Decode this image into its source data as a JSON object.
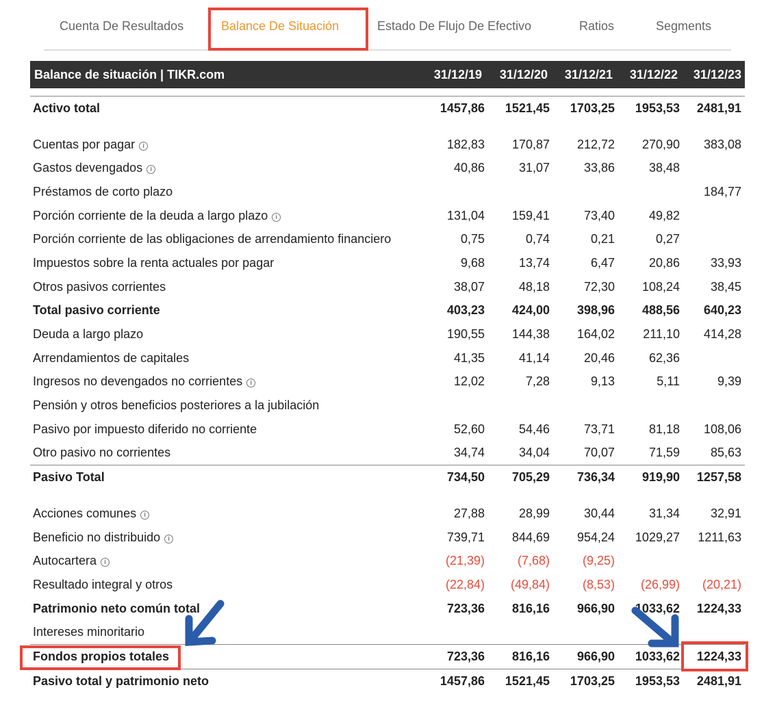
{
  "tabs": [
    {
      "label": "Cuenta De Resultados",
      "active": false
    },
    {
      "label": "Balance De Situación",
      "active": true
    },
    {
      "label": "Estado De Flujo De Efectivo",
      "active": false
    },
    {
      "label": "Ratios",
      "active": false
    },
    {
      "label": "Segments",
      "active": false
    }
  ],
  "table": {
    "title": "Balance de situación | TIKR.com",
    "dates": [
      "31/12/19",
      "31/12/20",
      "31/12/21",
      "31/12/22",
      "31/12/23"
    ],
    "rows": [
      {
        "label": "Activo total",
        "bold": true,
        "values": [
          "1457,86",
          "1521,45",
          "1703,25",
          "1953,53",
          "2481,91"
        ]
      },
      {
        "label": "Cuentas por pagar",
        "info": true,
        "values": [
          "182,83",
          "170,87",
          "212,72",
          "270,90",
          "383,08"
        ]
      },
      {
        "label": "Gastos devengados",
        "info": true,
        "values": [
          "40,86",
          "31,07",
          "33,86",
          "38,48",
          ""
        ]
      },
      {
        "label": "Préstamos de corto plazo",
        "values": [
          "",
          "",
          "",
          "",
          "184,77"
        ]
      },
      {
        "label": "Porción corriente de la deuda a largo plazo",
        "info": true,
        "values": [
          "131,04",
          "159,41",
          "73,40",
          "49,82",
          ""
        ]
      },
      {
        "label": "Porción corriente de las obligaciones de arrendamiento financiero",
        "values": [
          "0,75",
          "0,74",
          "0,21",
          "0,27",
          ""
        ]
      },
      {
        "label": "Impuestos sobre la renta actuales por pagar",
        "values": [
          "9,68",
          "13,74",
          "6,47",
          "20,86",
          "33,93"
        ]
      },
      {
        "label": "Otros pasivos corrientes",
        "values": [
          "38,07",
          "48,18",
          "72,30",
          "108,24",
          "38,45"
        ]
      },
      {
        "label": "Total pasivo corriente",
        "bold": true,
        "values": [
          "403,23",
          "424,00",
          "398,96",
          "488,56",
          "640,23"
        ]
      },
      {
        "label": "Deuda a largo plazo",
        "values": [
          "190,55",
          "144,38",
          "164,02",
          "211,10",
          "414,28"
        ]
      },
      {
        "label": "Arrendamientos de capitales",
        "values": [
          "41,35",
          "41,14",
          "20,46",
          "62,36",
          ""
        ]
      },
      {
        "label": "Ingresos no devengados no corrientes",
        "info": true,
        "values": [
          "12,02",
          "7,28",
          "9,13",
          "5,11",
          "9,39"
        ]
      },
      {
        "label": "Pensión y otros beneficios posteriores a la jubilación",
        "values": [
          "",
          "",
          "",
          "",
          ""
        ]
      },
      {
        "label": "Pasivo por impuesto diferido no corriente",
        "values": [
          "52,60",
          "54,46",
          "73,71",
          "81,18",
          "108,06"
        ]
      },
      {
        "label": "Otro pasivo no corrientes",
        "values": [
          "34,74",
          "34,04",
          "70,07",
          "71,59",
          "85,63"
        ]
      },
      {
        "label": "Pasivo Total",
        "bold": true,
        "values": [
          "734,50",
          "705,29",
          "736,34",
          "919,90",
          "1257,58"
        ]
      },
      {
        "label": "Acciones comunes",
        "info": true,
        "values": [
          "27,88",
          "28,99",
          "30,44",
          "31,34",
          "32,91"
        ]
      },
      {
        "label": "Beneficio no distribuido",
        "info": true,
        "values": [
          "739,71",
          "844,69",
          "954,24",
          "1029,27",
          "1211,63"
        ]
      },
      {
        "label": "Autocartera",
        "info": true,
        "values": [
          "(21,39)",
          "(7,68)",
          "(9,25)",
          "",
          ""
        ]
      },
      {
        "label": "Resultado integral y otros",
        "values": [
          "(22,84)",
          "(49,84)",
          "(8,53)",
          "(26,99)",
          "(20,21)"
        ]
      },
      {
        "label": "Patrimonio neto común total",
        "bold": true,
        "values": [
          "723,36",
          "816,16",
          "966,90",
          "1033,62",
          "1224,33"
        ]
      },
      {
        "label": "Intereses minoritario",
        "values": [
          "",
          "",
          "",
          "",
          ""
        ]
      },
      {
        "label": "Fondos propios totales",
        "bold": true,
        "values": [
          "723,36",
          "816,16",
          "966,90",
          "1033,62",
          "1224,33"
        ]
      },
      {
        "label": "Pasivo total y patrimonio neto",
        "bold": true,
        "values": [
          "1457,86",
          "1521,45",
          "1703,25",
          "1953,53",
          "2481,91"
        ]
      }
    ]
  },
  "colors": {
    "accent": "#f0962e",
    "negative": "#e74c3c",
    "highlight_box": "#e8453c",
    "annotation_arrow": "#2a5caa",
    "header_bg": "#333333"
  }
}
